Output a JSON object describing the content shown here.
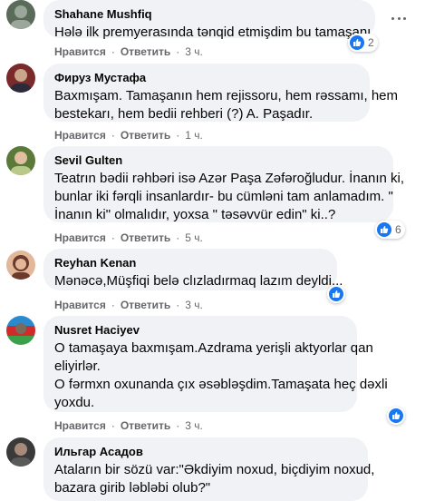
{
  "comments": [
    {
      "author": "Shahane Mushfiq",
      "lines": [
        "Hələ ilk premyerasında tənqid etmişdim bu tamaşanı"
      ],
      "like": "Нравится",
      "reply": "Ответить",
      "time": "3 ч.",
      "reaction_count": "2",
      "avatar_colors": [
        "#5a6b5a",
        "#9aa79a"
      ]
    },
    {
      "author": "Фируз Мустафа",
      "lines": [
        "Baxmışam. Tamaşanın hem rejissoru, hem rəssamı, hem",
        "bestekarı, hem bedii rehberi (?) A. Paşadır."
      ],
      "like": "Нравится",
      "reply": "Ответить",
      "time": "1 ч.",
      "avatar_colors": [
        "#7a2a2a",
        "#c9a58a"
      ]
    },
    {
      "author": "Sevil Gulten",
      "lines": [
        "Teatrın bədii rəhbəri isə Azər Paşa Zəfəroğludur. İnanın ki,",
        "bunlar iki fərqli insanlardır- bu cümləni tam anlamadım. \"",
        "İnanın ki\" olmalıdır, yoxsa \" təsəvvür edin\" ki..?"
      ],
      "like": "Нравится",
      "reply": "Ответить",
      "time": "5 ч.",
      "reaction_count": "6",
      "avatar_colors": [
        "#5b7a3a",
        "#b8c98a"
      ]
    },
    {
      "author": "Reyhan Kenan",
      "lines": [
        "Mənəcə,Müşfiqi belə clızladırmaq lazım deyldi..."
      ],
      "like": "Нравится",
      "reply": "Ответить",
      "time": "3 ч.",
      "avatar_colors": [
        "#6b3a2a",
        "#e3b89a"
      ]
    },
    {
      "author": "Nusret Haciyev",
      "lines": [
        "O tamaşaya baxmışam.Azdrama yerişli aktyorlar qan",
        "eliyirlər.",
        "O fərmxn oxunanda çıx əsəbləşdim.Tamaşata heç dəxli",
        "yoxdu."
      ],
      "like": "Нравится",
      "reply": "Ответить",
      "time": "3 ч.",
      "avatar_colors": [
        "#2a6b9a",
        "#3aa04a"
      ]
    },
    {
      "author": "Ильгар Асадов",
      "lines": [
        "Ataların bir sözü var:\"Əkdiyim noxud, biçdiyim noxud,",
        "bazara girib ləbləbi olub?\""
      ],
      "avatar_colors": [
        "#3a3a3a",
        "#a88a7a"
      ]
    }
  ],
  "colors": {
    "bubble": "#f0f2f5",
    "meta_text": "#65676b",
    "like_blue": "#1877f2"
  },
  "icons": [
    "more-options-icon",
    "like-reaction-icon"
  ]
}
